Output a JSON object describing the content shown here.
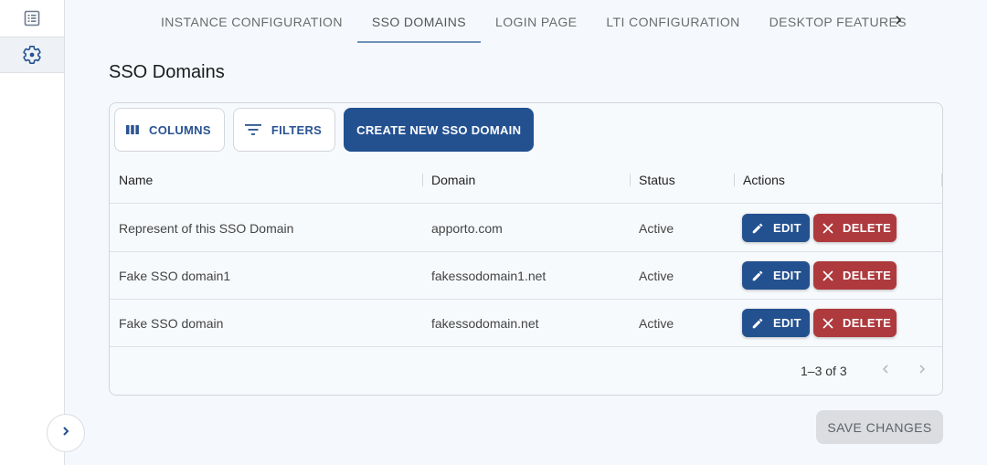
{
  "sidebar": {
    "items": [
      {
        "icon": "list-icon",
        "active": false
      },
      {
        "icon": "gear-icon",
        "active": true
      }
    ],
    "expand_icon": "chevron-right-icon"
  },
  "tabs": [
    {
      "label": "INSTANCE CONFIGURATION",
      "active": false
    },
    {
      "label": "SSO DOMAINS",
      "active": true
    },
    {
      "label": "LOGIN PAGE",
      "active": false
    },
    {
      "label": "LTI CONFIGURATION",
      "active": false
    },
    {
      "label": "DESKTOP FEATURES",
      "active": false
    }
  ],
  "tab_scroll_icon": "chevron-right-icon",
  "page": {
    "title": "SSO Domains"
  },
  "toolbar": {
    "columns_label": "COLUMNS",
    "filters_label": "FILTERS",
    "create_label": "CREATE NEW SSO DOMAIN"
  },
  "table": {
    "columns": [
      "Name",
      "Domain",
      "Status",
      "Actions"
    ],
    "rows": [
      {
        "name": "Represent of this SSO Domain",
        "domain": "apporto.com",
        "status": "Active",
        "edit": "EDIT",
        "delete": "DELETE"
      },
      {
        "name": "Fake SSO domain1",
        "domain": "fakessodomain1.net",
        "status": "Active",
        "edit": "EDIT",
        "delete": "DELETE"
      },
      {
        "name": "Fake SSO domain",
        "domain": "fakessodomain.net",
        "status": "Active",
        "edit": "EDIT",
        "delete": "DELETE"
      }
    ],
    "pagination": {
      "text": "1–3 of 3"
    }
  },
  "save_label": "SAVE CHANGES",
  "colors": {
    "primary": "#235190",
    "danger": "#ae3a3e",
    "tab_indicator": "#7092b8"
  }
}
